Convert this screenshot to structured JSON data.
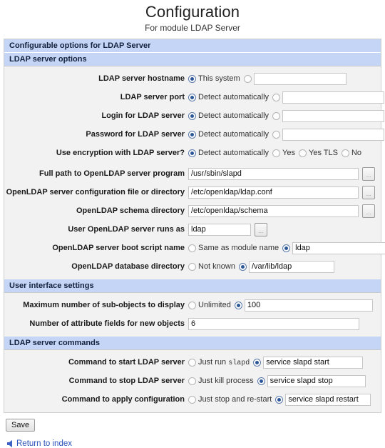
{
  "header": {
    "title": "Configuration",
    "subtitle": "For module LDAP Server"
  },
  "bands": {
    "configurable": "Configurable options for LDAP Server",
    "server_options": "LDAP server options",
    "ui_settings": "User interface settings",
    "server_commands": "LDAP server commands"
  },
  "rows": {
    "hostname": {
      "label": "LDAP server hostname",
      "opt1": "This system",
      "opt1_selected": true,
      "value": "",
      "placeholder": ""
    },
    "port": {
      "label": "LDAP server port",
      "opt1": "Detect automatically",
      "opt1_selected": true,
      "value": ""
    },
    "login": {
      "label": "Login for LDAP server",
      "opt1": "Detect automatically",
      "opt1_selected": true,
      "value": ""
    },
    "password": {
      "label": "Password for LDAP server",
      "opt1": "Detect automatically",
      "opt1_selected": true,
      "value": ""
    },
    "encryption": {
      "label": "Use encryption with LDAP server?",
      "opt1": "Detect automatically",
      "opt2": "Yes",
      "opt3": "Yes TLS",
      "opt4": "No",
      "selected": "Detect automatically"
    },
    "program_path": {
      "label": "Full path to OpenLDAP server program",
      "value": "/usr/sbin/slapd",
      "chooser": "..."
    },
    "config_path": {
      "label": "OpenLDAP server configuration file or directory",
      "value": "/etc/openldap/ldap.conf",
      "chooser": "..."
    },
    "schema_path": {
      "label": "OpenLDAP schema directory",
      "value": "/etc/openldap/schema",
      "chooser": "..."
    },
    "run_as_user": {
      "label": "User OpenLDAP server runs as",
      "value": "ldap",
      "chooser": "..."
    },
    "boot_script": {
      "label": "OpenLDAP server boot script name",
      "opt1": "Same as module name",
      "opt1_selected": false,
      "opt2_selected": true,
      "value": "ldap"
    },
    "db_directory": {
      "label": "OpenLDAP database directory",
      "opt1": "Not known",
      "opt1_selected": false,
      "opt2_selected": true,
      "value": "/var/lib/ldap"
    },
    "max_subobjects": {
      "label": "Maximum number of sub-objects to display",
      "opt1": "Unlimited",
      "opt1_selected": false,
      "opt2_selected": true,
      "value": "100"
    },
    "attr_fields": {
      "label": "Number of attribute fields for new objects",
      "value": "6"
    },
    "cmd_start": {
      "label": "Command to start LDAP server",
      "opt1_prefix": "Just run ",
      "opt1_mono": "slapd",
      "opt1_selected": false,
      "opt2_selected": true,
      "value": "service slapd start"
    },
    "cmd_stop": {
      "label": "Command to stop LDAP server",
      "opt1": "Just kill process",
      "opt1_selected": false,
      "opt2_selected": true,
      "value": "service slapd stop"
    },
    "cmd_apply": {
      "label": "Command to apply configuration",
      "opt1": "Just stop and re-start",
      "opt1_selected": false,
      "opt2_selected": true,
      "value": "service slapd restart"
    }
  },
  "footer": {
    "save_label": "Save",
    "return_label": "Return to index",
    "return_icon": "arrow-left-icon"
  },
  "colors": {
    "band": "#c5d5f5",
    "body": "#f2f2f2",
    "radio_dot": "#2b5797",
    "link": "#2b52b8"
  }
}
